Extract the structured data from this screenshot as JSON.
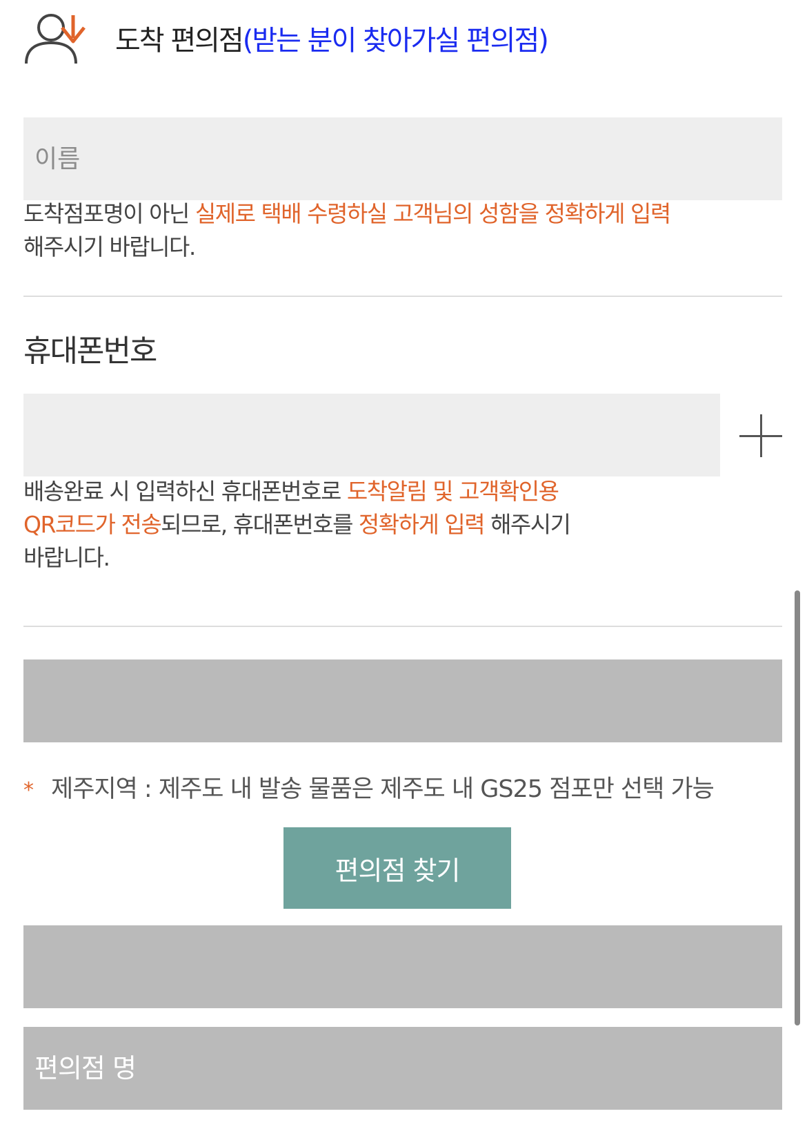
{
  "header": {
    "title": "도착 편의점",
    "subtitle": "(받는 분이 찾아가실 편의점)"
  },
  "name_field": {
    "placeholder": "이름",
    "help_prefix": "도착점포명이 아닌 ",
    "help_highlight": "실제로 택배 수령하실 고객님의 성함을 정확하게 입력",
    "help_suffix": "해주시기 바랍니다."
  },
  "phone": {
    "label": "휴대폰번호",
    "help_line1_prefix": "배송완료 시 입력하신 휴대폰번호로 ",
    "help_line1_highlight": "도착알림 및 고객확인용",
    "help_line2_highlight": "QR코드가 전송",
    "help_line2_mid": "되므로, 휴대폰번호를 ",
    "help_line2_highlight2": "정확하게 입력",
    "help_line2_suffix": " 해주시기",
    "help_line3": "바랍니다."
  },
  "notice": {
    "star": "*",
    "text": "제주지역 : 제주도 내 발송 물품은 제주도 내 GS25 점포만 선택 가능"
  },
  "find_button_label": "편의점 찾기",
  "store_name_placeholder": "편의점 명",
  "colors": {
    "accent": "#e0642b",
    "subtitle": "#1a2bf0",
    "button": "#6fa39d",
    "disabled_field": "#bababa",
    "input_bg": "#eeeeee"
  }
}
